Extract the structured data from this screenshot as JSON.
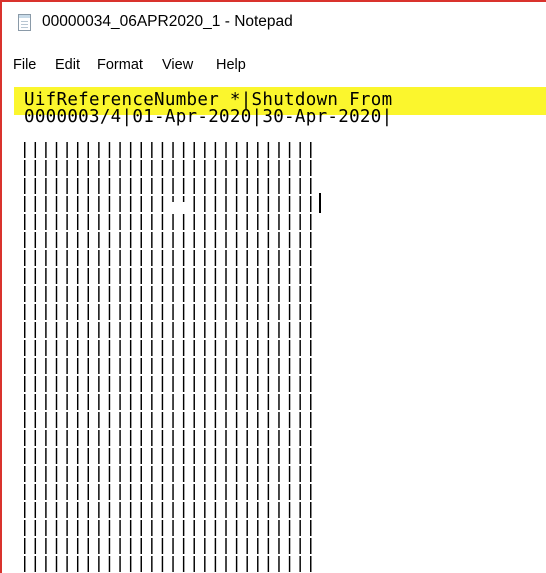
{
  "window": {
    "title": "00000034_06APR2020_1 - Notepad",
    "app_icon": "notepad-icon"
  },
  "menu": {
    "items": [
      "File",
      "Edit",
      "Format",
      "View",
      "Help"
    ]
  },
  "editor": {
    "highlight_color": "#fbf62d",
    "lines": [
      "UifReferenceNumber *|Shutdown From",
      "0000003/4|01-Apr-2020|30-Apr-2020|"
    ],
    "repeated_text": "|||||||||||||||||||||||||"
  }
}
